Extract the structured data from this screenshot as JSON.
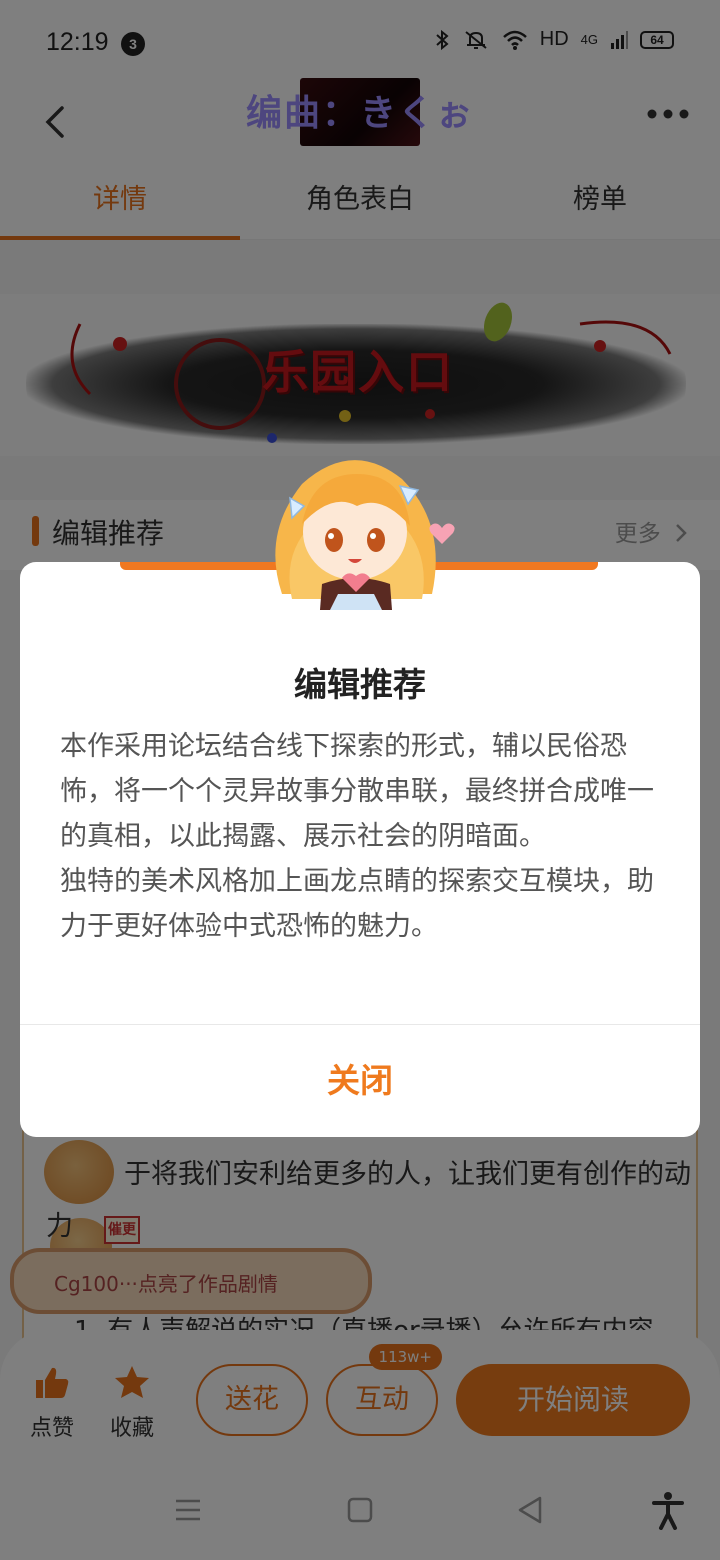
{
  "status_bar": {
    "time": "12:19",
    "notification_count": "3",
    "network": "HD",
    "signal_type": "4G",
    "battery": "64"
  },
  "header": {
    "title": "编曲：きくぉ"
  },
  "tabs": [
    {
      "label": "详情",
      "active": true
    },
    {
      "label": "角色表白",
      "active": false
    },
    {
      "label": "榜单",
      "active": false
    }
  ],
  "banner": {
    "title": "乐园入口"
  },
  "section": {
    "title": "编辑推荐",
    "more": "更多"
  },
  "modal": {
    "title": "编辑推荐",
    "paragraphs": [
      "本作采用论坛结合线下探索的形式，辅以民俗恐怖，将一个个灵异故事分散串联，最终拼合成唯一的真相，以此揭露、展示社会的阴暗面。",
      "独特的美术风格加上画龙点睛的探索交互模块，助力于更好体验中式恐怖的魅力。"
    ],
    "close_label": "关闭"
  },
  "comments": {
    "line1": "于将我们安利给更多的人，让我们更有创作的动",
    "line1_tail": "力",
    "tag": "催更",
    "bubble": "Cg100···点亮了作品剧情",
    "line2": "1. 有人声解说的实况（直播or录播）允许所有内容"
  },
  "bottom_bar": {
    "like_label": "点赞",
    "favorite_label": "收藏",
    "gift_label": "送花",
    "interact_label": "互动",
    "interact_badge": "113w+",
    "read_label": "开始阅读"
  },
  "colors": {
    "accent": "#ef7a1e",
    "title_purple": "#9b8cff"
  }
}
